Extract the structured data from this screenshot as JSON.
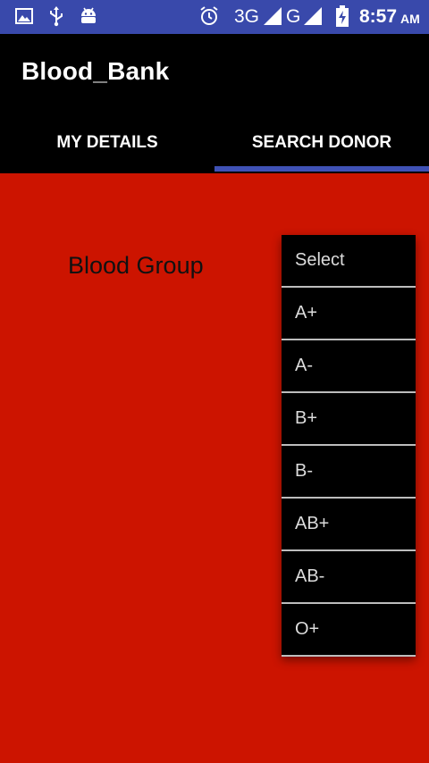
{
  "status_bar": {
    "network_1": "3G",
    "network_2": "G",
    "time": "8:57",
    "ampm": "AM",
    "icons": [
      "gallery-icon",
      "usb-icon",
      "android-debug-icon",
      "alarm-icon",
      "signal-icon",
      "battery-charging-icon"
    ]
  },
  "app_bar": {
    "title": "Blood_Bank"
  },
  "tabs": [
    {
      "label": "MY DETAILS",
      "selected": false
    },
    {
      "label": "SEARCH DONOR",
      "selected": true
    }
  ],
  "content": {
    "blood_group_label": "Blood Group"
  },
  "dropdown": {
    "options": [
      "Select",
      "A+",
      "A-",
      "B+",
      "B-",
      "AB+",
      "AB-",
      "O+"
    ]
  },
  "colors": {
    "status_bar": "#3949ab",
    "app_bar": "#000000",
    "tab_indicator": "#3f51b5",
    "background": "#cc1400"
  }
}
